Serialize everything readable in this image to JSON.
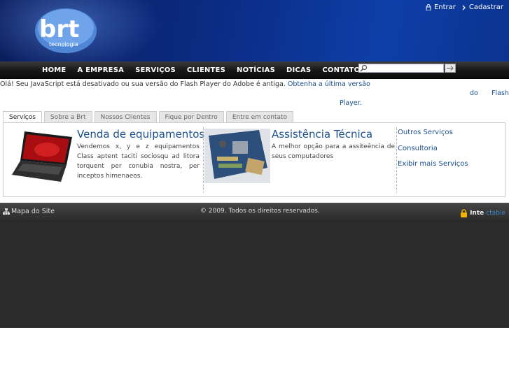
{
  "brand": {
    "name": "brt",
    "tagline": "tecnologia"
  },
  "top_links": [
    {
      "icon": "lock-icon",
      "label": "Entrar"
    },
    {
      "icon": "chevron-right-icon",
      "label": "Cadastrar"
    }
  ],
  "nav": [
    "HOME",
    "A EMPRESA",
    "SERVIÇOS",
    "CLIENTES",
    "NOTÍCIAS",
    "DICAS",
    "CONTATO"
  ],
  "search": {
    "placeholder": "",
    "value": ""
  },
  "notice": {
    "text": "Olá! Seu JavaScript está desativado ou sua versão do Flash Player do Adobe é antiga.",
    "link_line1": "Obtenha a última versão",
    "link_do": "do",
    "link_flash": "Flash",
    "link_player": "Player."
  },
  "tabs": [
    "Serviços",
    "Sobre a Brt",
    "Nossos Clientes",
    "Fique por Dentro",
    "Entre em contato"
  ],
  "features": [
    {
      "title": "Venda de equipamentos",
      "text": "Vendemos x, y e z equipamentos Class aptent taciti sociosqu ad litora torquent per conubia nostra, per inceptos himenaeos.",
      "image": "laptop"
    },
    {
      "title": "Assistência Técnica",
      "text": "A melhor opção para a assiteência de seus computadores",
      "image": "motherboard"
    }
  ],
  "services": [
    "Outros Serviços",
    "Consultoria",
    "Exibir mais Serviços"
  ],
  "footer": {
    "sitemap": "Mapa do Site",
    "copyright": "© 2009. Todos os direitos reservados.",
    "badge_a": "Inte",
    "badge_b": "ctable"
  },
  "colors": {
    "header_blue": "#0b2d86",
    "link_blue": "#1b4f91",
    "footer_dark": "#2b2b2b"
  }
}
